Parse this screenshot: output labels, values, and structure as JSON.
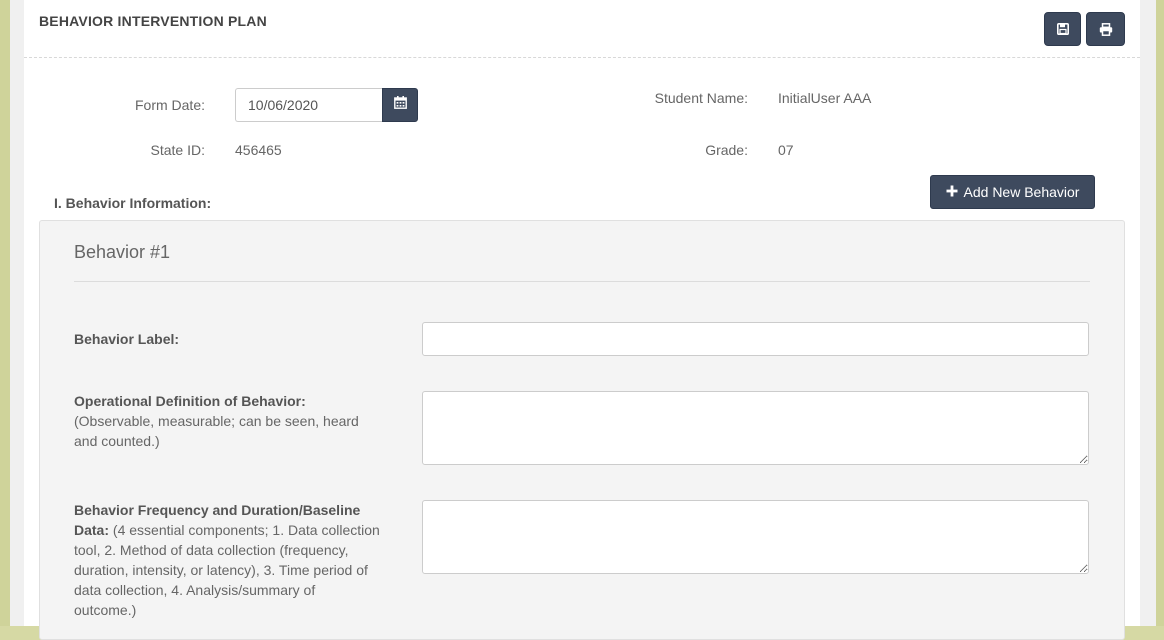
{
  "header": {
    "title": "BEHAVIOR INTERVENTION PLAN",
    "save_icon": "floppy-disk-icon",
    "print_icon": "printer-icon"
  },
  "form": {
    "form_date_label": "Form Date:",
    "form_date_value": "10/06/2020",
    "calendar_icon": "calendar-icon",
    "student_name_label": "Student Name:",
    "student_name_value": "InitialUser AAA",
    "state_id_label": "State ID:",
    "state_id_value": "456465",
    "grade_label": "Grade:",
    "grade_value": "07"
  },
  "section": {
    "title": "I. Behavior Information:",
    "add_button_label": "Add New Behavior",
    "add_icon": "plus-icon"
  },
  "behavior": {
    "title": "Behavior #1",
    "label_field_label": "Behavior Label:",
    "label_field_value": "",
    "definition_label_bold": "Operational Definition of Behavior:",
    "definition_label_note": "(Observable, measurable; can be seen, heard and counted.)",
    "definition_value": "",
    "frequency_label_bold": "Behavior Frequency and Duration/Baseline Data:",
    "frequency_label_note": " (4 essential components; 1. Data collection tool, 2. Method of data collection (frequency, duration, intensity, or latency), 3. Time period of data collection, 4. Analysis/summary of outcome.)",
    "frequency_value": ""
  },
  "colors": {
    "button_bg": "#3e4a5e",
    "page_bg": "#d6d9a4",
    "panel_bg": "#f4f4f4"
  }
}
